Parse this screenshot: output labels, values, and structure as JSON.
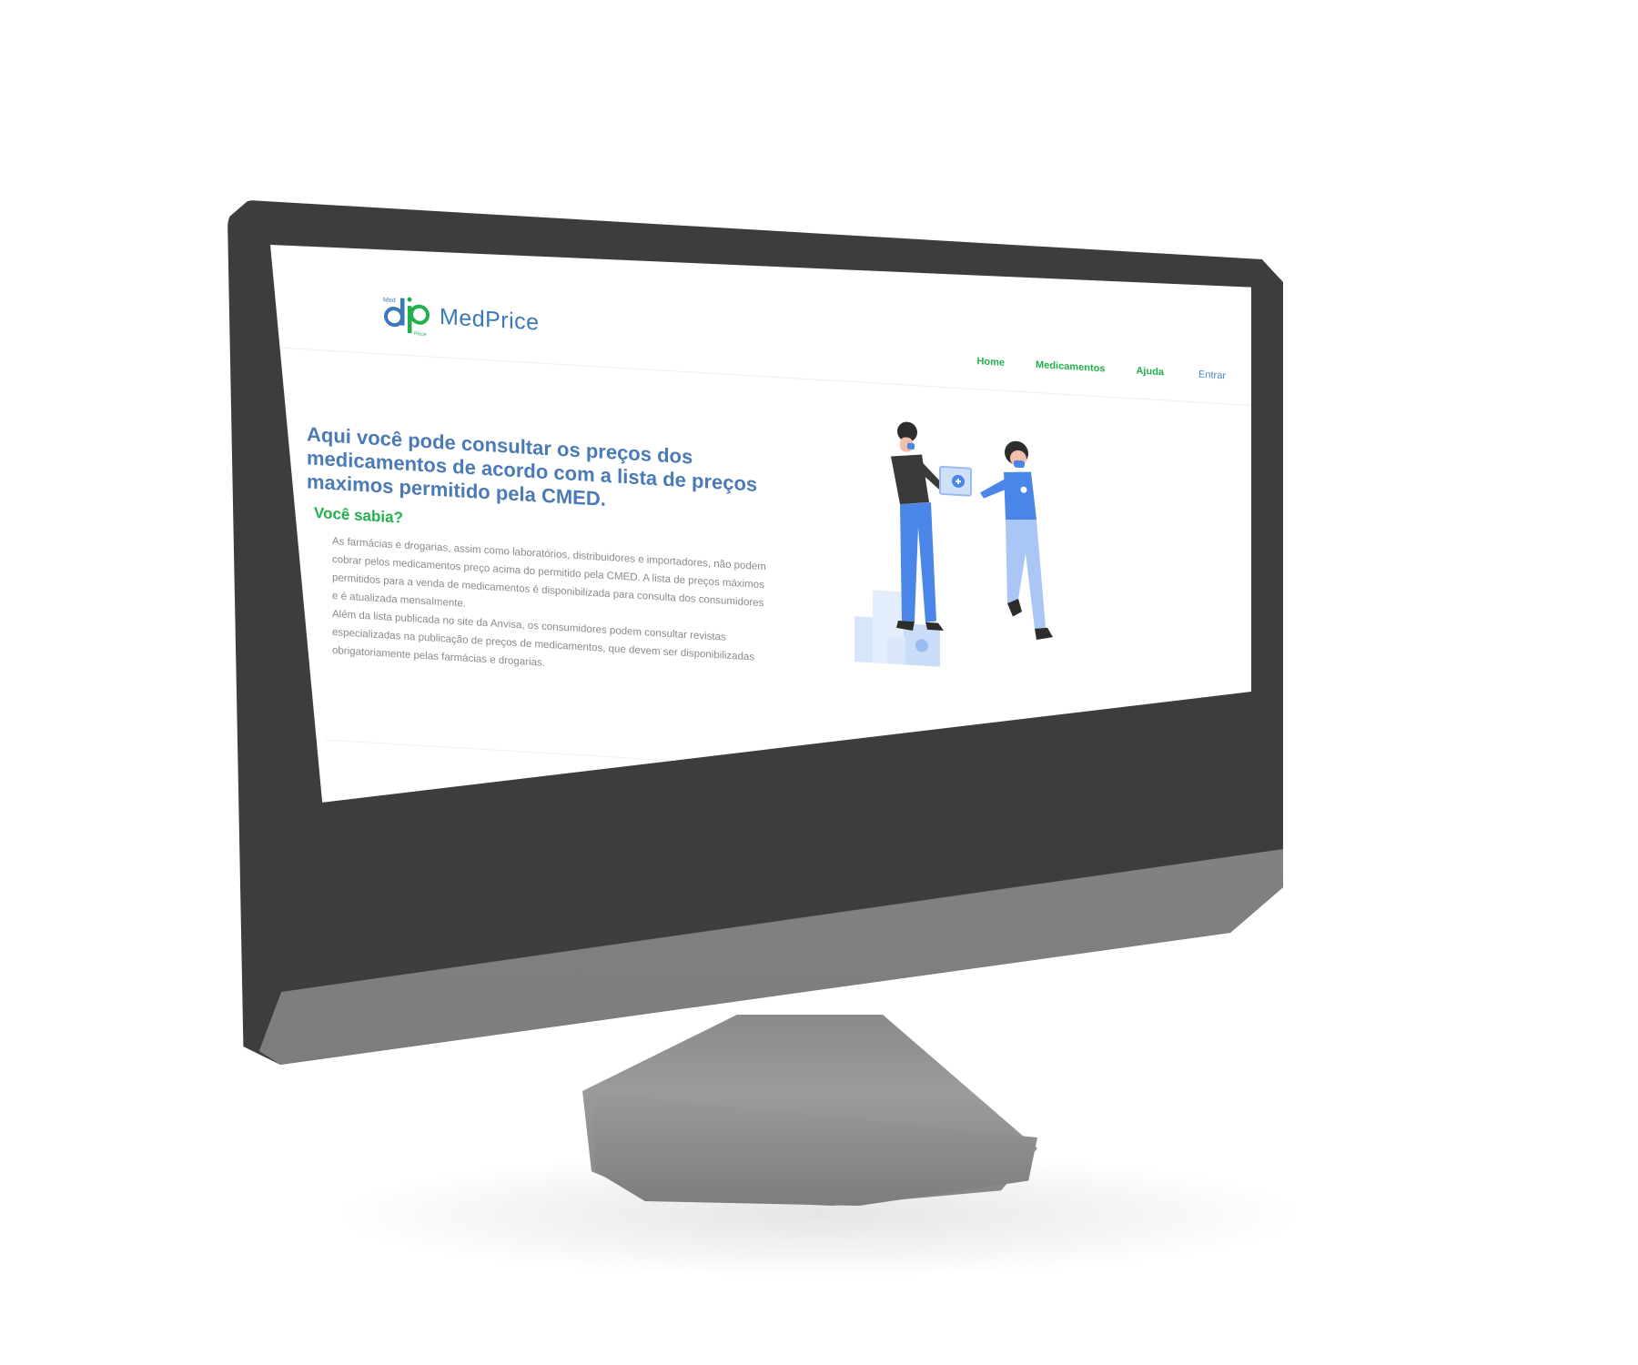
{
  "site": {
    "brand": {
      "name": "MedPrice",
      "mark_letters": "dp",
      "mark_small_top": "Med",
      "mark_small_bottom": "Price",
      "colors": {
        "primary": "#3a78b8",
        "accent": "#21b04b"
      }
    },
    "nav": {
      "items": [
        "Home",
        "Medicamentos",
        "Ajuda",
        "Entrar"
      ]
    },
    "hero": {
      "title": "Aqui você pode consultar os preços dos medicamentos de acordo com a lista de preços maximos permitido pela CMED.",
      "subtitle": "Você sabia?",
      "paragraphs": [
        "As farmácias e drogarias, assim como laboratórios, distribuidores e importadores, não podem cobrar pelos medicamentos preço acima do permitido pela CMED. A lista de preços máximos permitidos para a venda de medicamentos é disponibilizada para consulta dos consumidores e é atualizada mensalmente.",
        "Além da lista publicada no site da Anvisa, os consumidores podem consultar revistas especializadas na publicação de preços de medicamentos, que devem ser disponibilizadas obrigatoriamente pelas farmácias e drogarias."
      ]
    },
    "illustration": {
      "icon": "pharmacy-handover-illustration"
    }
  },
  "device": {
    "bezel_color": "#3d3d3d",
    "chin_color": "#8e8e8e",
    "stand_color": "#8a8a8a"
  }
}
